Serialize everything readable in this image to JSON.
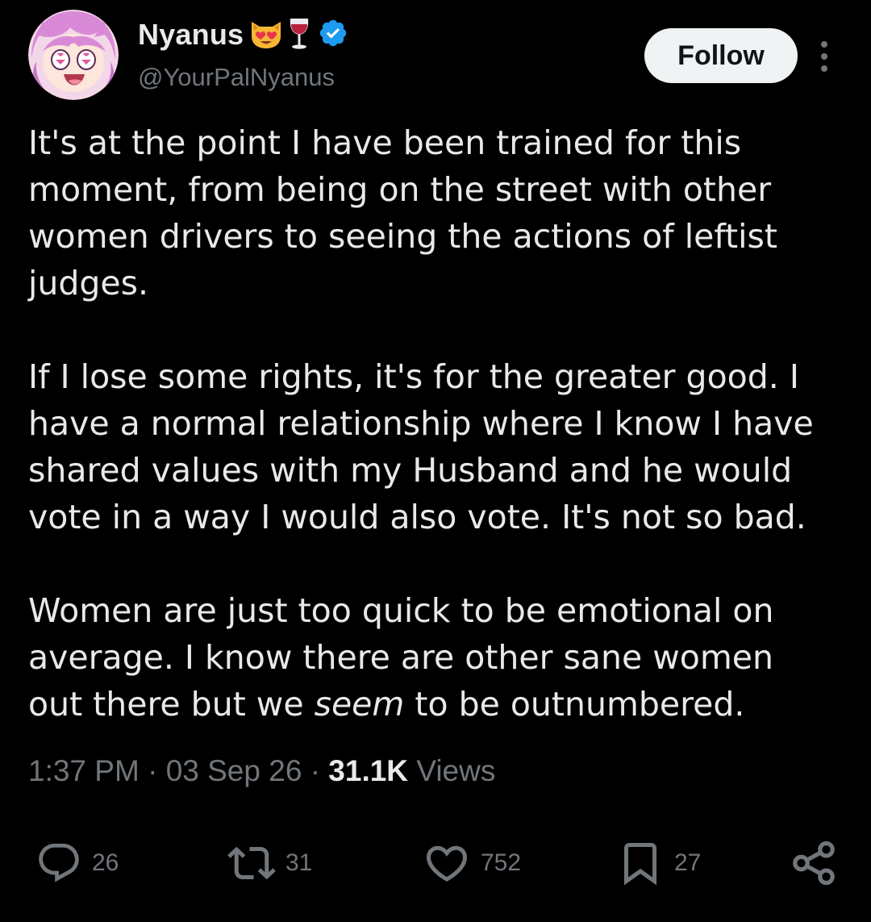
{
  "author": {
    "name": "Nyanus",
    "name_emojis": [
      "heart-eyes-cat-emoji",
      "wine-glass-emoji"
    ],
    "verified": true,
    "handle": "@YourPalNyanus",
    "avatar_icon": "anime-girl-avatar"
  },
  "header": {
    "follow_label": "Follow",
    "more_icon": "more-vertical-icon"
  },
  "tweet": {
    "paragraph_1": "It's at the point I have been trained for this\nmoment, from being on the street with other\nwomen drivers to seeing the actions of leftist\njudges.",
    "paragraph_2": "If I lose some rights, it's for the greater good. I\nhave a normal relationship where I know I have\nshared values with my Husband and he would\nvote in a way I would also vote. It's not so bad.",
    "paragraph_3_before": "Women are just too quick to be emotional on\naverage. I know there are other sane women\nout there but we ",
    "paragraph_3_emphasis": "seem",
    "paragraph_3_after": " to be outnumbered."
  },
  "meta": {
    "time": "1:37 PM",
    "date": "03 Sep 26",
    "views_count": "31.1K",
    "views_label": "Views",
    "separator": "·"
  },
  "actions": {
    "replies": "26",
    "reposts": "31",
    "likes": "752",
    "bookmarks": "27"
  },
  "colors": {
    "background": "#000000",
    "text_primary": "#e7e9ea",
    "text_secondary": "#71767b",
    "verified_blue": "#1d9bf0",
    "follow_bg": "#eff3f4"
  }
}
